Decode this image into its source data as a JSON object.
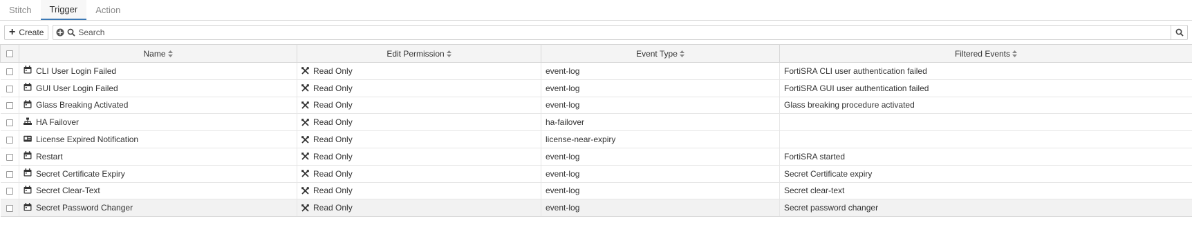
{
  "tabs": [
    {
      "label": "Stitch",
      "active": false
    },
    {
      "label": "Trigger",
      "active": true
    },
    {
      "label": "Action",
      "active": false
    }
  ],
  "toolbar": {
    "create_label": "Create",
    "search_placeholder": "Search"
  },
  "columns": [
    "Name",
    "Edit Permission",
    "Event Type",
    "Filtered Events"
  ],
  "rows": [
    {
      "name": "CLI User Login Failed",
      "icon": "calendar-icon",
      "permission": "Read Only",
      "event_type": "event-log",
      "filtered": "FortiSRA CLI user authentication failed"
    },
    {
      "name": "GUI User Login Failed",
      "icon": "calendar-icon",
      "permission": "Read Only",
      "event_type": "event-log",
      "filtered": "FortiSRA GUI user authentication failed"
    },
    {
      "name": "Glass Breaking Activated",
      "icon": "calendar-icon",
      "permission": "Read Only",
      "event_type": "event-log",
      "filtered": "Glass breaking procedure activated"
    },
    {
      "name": "HA Failover",
      "icon": "sitemap-icon",
      "permission": "Read Only",
      "event_type": "ha-failover",
      "filtered": ""
    },
    {
      "name": "License Expired Notification",
      "icon": "id-card-icon",
      "permission": "Read Only",
      "event_type": "license-near-expiry",
      "filtered": ""
    },
    {
      "name": "Restart",
      "icon": "calendar-icon",
      "permission": "Read Only",
      "event_type": "event-log",
      "filtered": "FortiSRA started"
    },
    {
      "name": "Secret Certificate Expiry",
      "icon": "calendar-icon",
      "permission": "Read Only",
      "event_type": "event-log",
      "filtered": "Secret Certificate expiry"
    },
    {
      "name": "Secret Clear-Text",
      "icon": "calendar-icon",
      "permission": "Read Only",
      "event_type": "event-log",
      "filtered": "Secret clear-text"
    },
    {
      "name": "Secret Password Changer",
      "icon": "calendar-icon",
      "permission": "Read Only",
      "event_type": "event-log",
      "filtered": "Secret password changer"
    }
  ],
  "colors": {
    "accent": "#3c79b5",
    "header_bg": "#f4f4f4",
    "selected_row_bg": "#f2f2f2"
  }
}
